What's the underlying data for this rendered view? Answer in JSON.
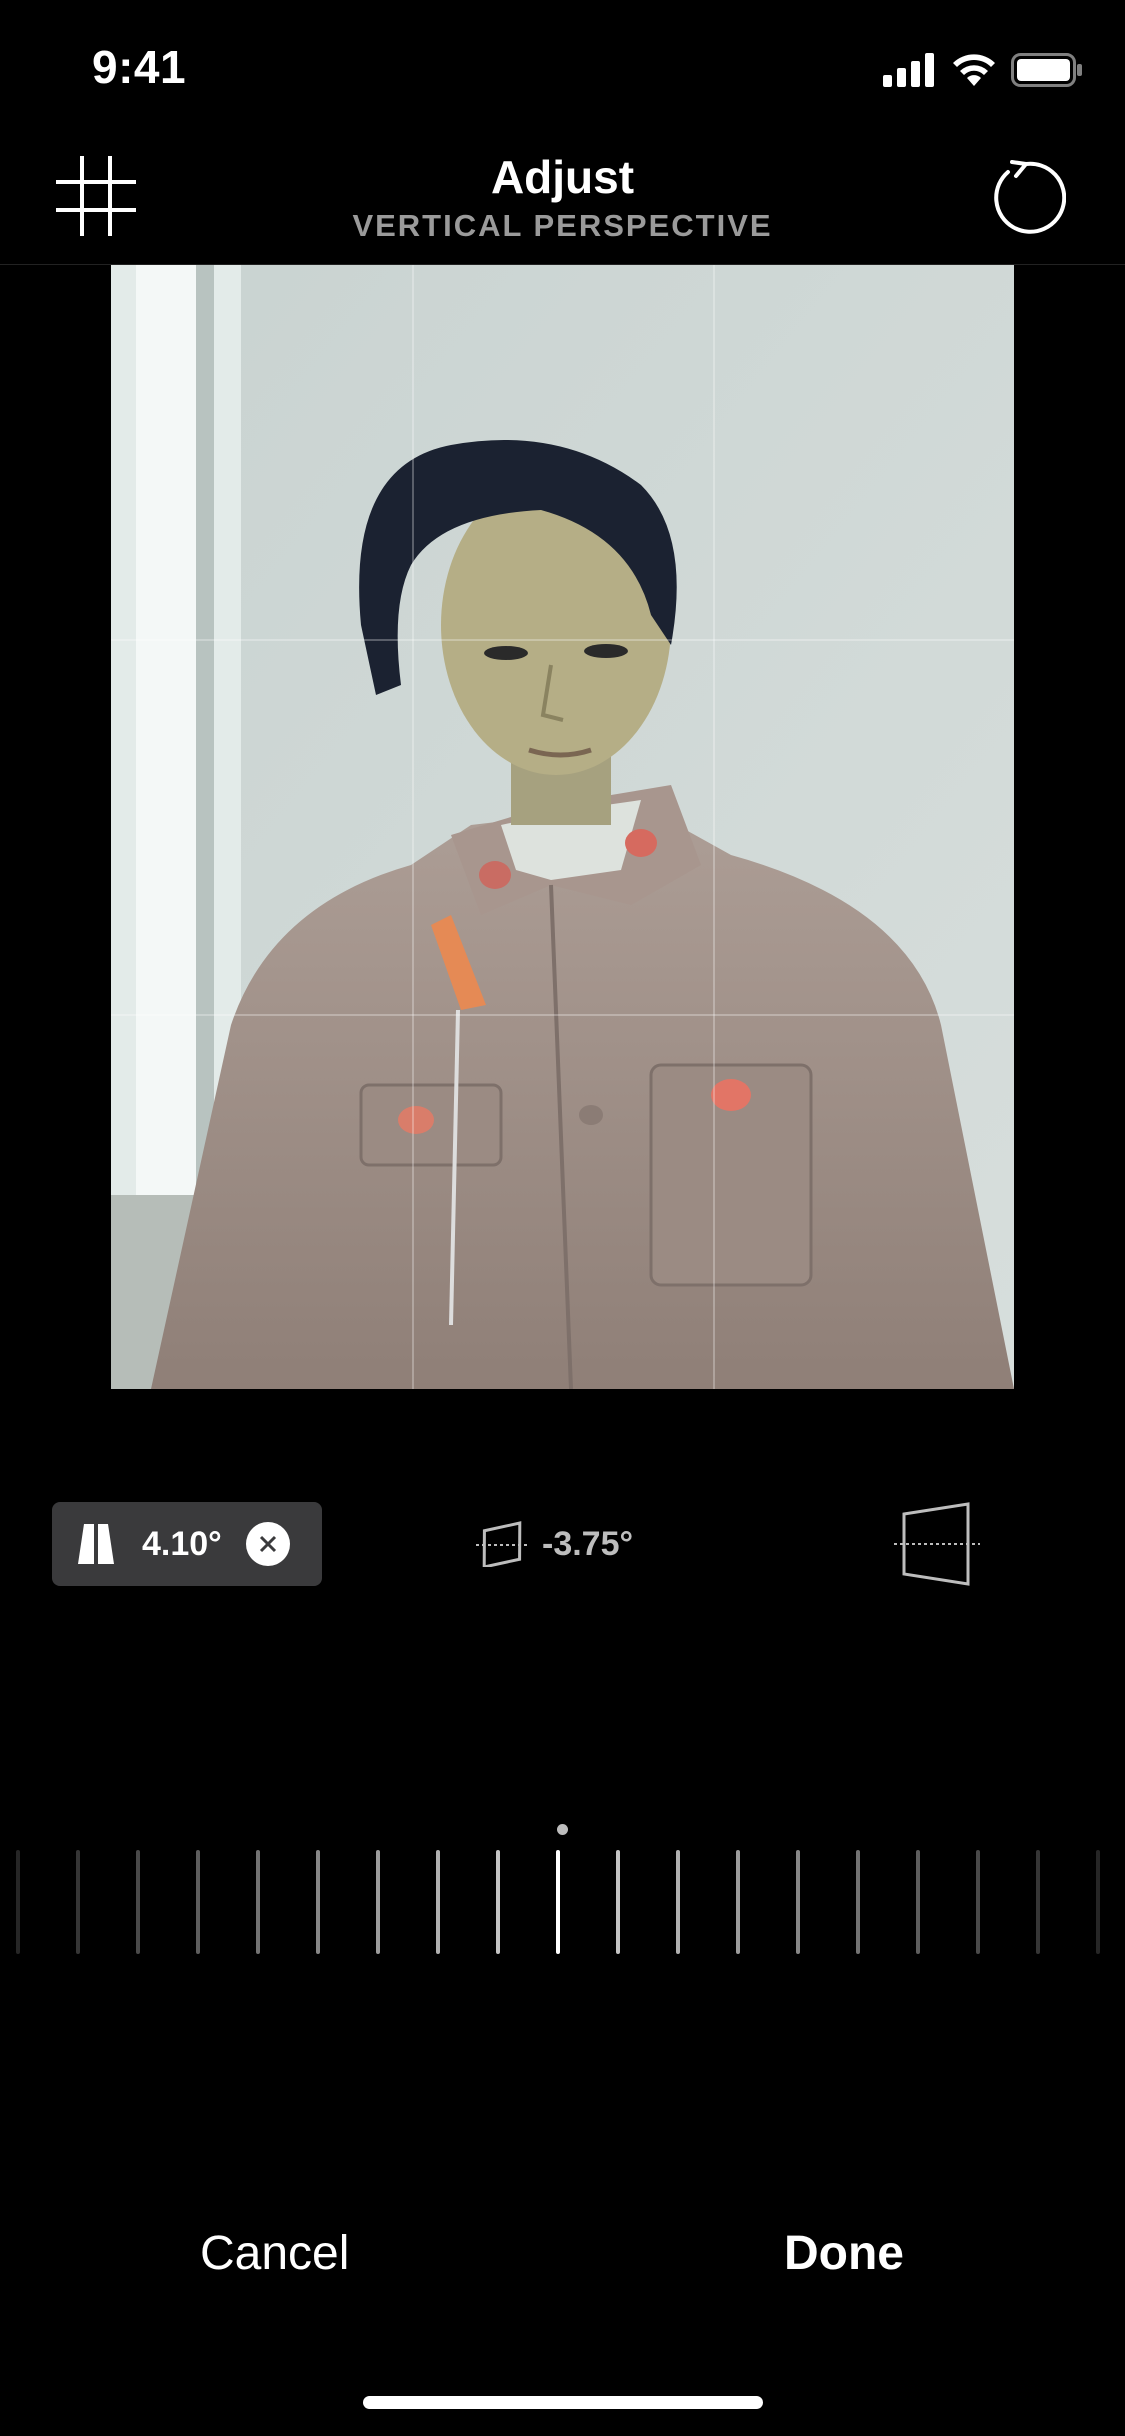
{
  "status_bar": {
    "time": "9:41",
    "icons": [
      "cellular-signal-icon",
      "wifi-icon",
      "battery-icon"
    ]
  },
  "header": {
    "title": "Adjust",
    "subtitle": "VERTICAL PERSPECTIVE",
    "left_icon": "grid-icon",
    "right_icon": "reset-rotate-icon"
  },
  "photo": {
    "description_icon": "photo-being-edited",
    "grid": "3x3 overlay"
  },
  "controls": {
    "vertical_perspective": {
      "icon": "vertical-perspective-icon",
      "value": "4.10°",
      "active": true
    },
    "rotation": {
      "icon": "rotate-icon",
      "value": "-3.75°"
    },
    "horizontal_perspective": {
      "icon": "horizontal-perspective-icon"
    }
  },
  "ruler": {
    "selected_value": "4.10°"
  },
  "footer": {
    "cancel_label": "Cancel",
    "done_label": "Done"
  },
  "colors": {
    "background": "#000000",
    "active_chip": "#3a3a3c",
    "subtitle": "#9a9a9a"
  }
}
